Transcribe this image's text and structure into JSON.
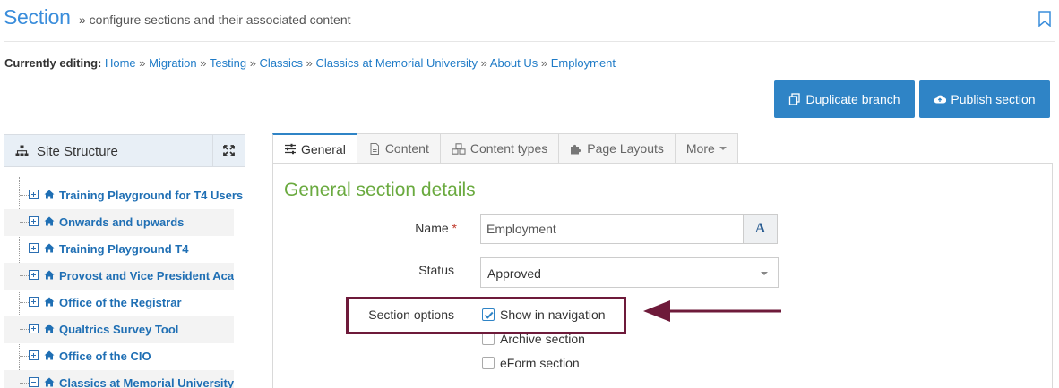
{
  "header": {
    "title": "Section",
    "subtitle": "» configure sections and their associated content",
    "bookmark_icon": "bookmark-icon"
  },
  "breadcrumb": {
    "label": "Currently editing:",
    "items": [
      "Home",
      "Migration",
      "Testing",
      "Classics",
      "Classics at Memorial University",
      "About Us",
      "Employment"
    ],
    "separator": "»"
  },
  "actions": {
    "duplicate_label": "Duplicate branch",
    "publish_label": "Publish section",
    "accent_color": "#2f84c6"
  },
  "sidebar": {
    "title": "Site Structure",
    "items": [
      {
        "label": "Training Playground for T4 Users",
        "state": "collapsed"
      },
      {
        "label": "Onwards and upwards",
        "state": "collapsed"
      },
      {
        "label": "Training Playground T4",
        "state": "collapsed"
      },
      {
        "label": "Provost and Vice President Academic",
        "state": "collapsed"
      },
      {
        "label": "Office of the Registrar",
        "state": "collapsed"
      },
      {
        "label": "Qualtrics Survey Tool",
        "state": "collapsed"
      },
      {
        "label": "Office of the CIO",
        "state": "collapsed"
      },
      {
        "label": "Classics at Memorial University",
        "state": "expanded"
      }
    ]
  },
  "tabs": [
    {
      "label": "General",
      "icon": "sliders-icon",
      "active": true
    },
    {
      "label": "Content",
      "icon": "document-icon",
      "active": false
    },
    {
      "label": "Content types",
      "icon": "cubes-icon",
      "active": false
    },
    {
      "label": "Page Layouts",
      "icon": "puzzle-icon",
      "active": false
    },
    {
      "label": "More",
      "icon": "caret-down-icon",
      "active": false
    }
  ],
  "form": {
    "heading": "General section details",
    "name_label": "Name",
    "required_mark": "*",
    "name_value": "Employment",
    "name_button": "A",
    "status_label": "Status",
    "status_value": "Approved",
    "options_label": "Section options",
    "options": [
      {
        "label": "Show in navigation",
        "checked": true
      },
      {
        "label": "Archive section",
        "checked": false
      },
      {
        "label": "eForm section",
        "checked": false
      }
    ]
  },
  "annotation": {
    "highlight_color": "#6e1a3a"
  }
}
